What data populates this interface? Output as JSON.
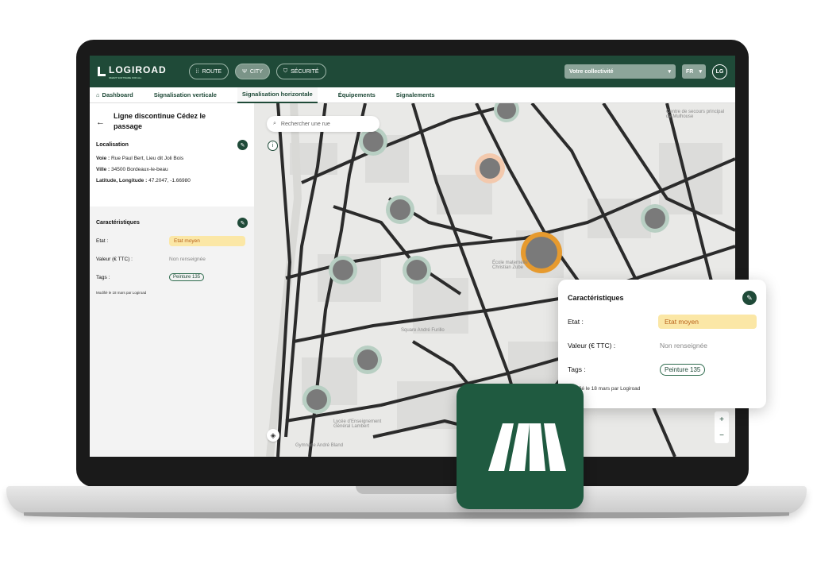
{
  "header": {
    "logo_text": "LOGIROAD",
    "logo_sub": "SMART SOFTWARE FOR ALL",
    "modes": [
      {
        "label": "ROUTE",
        "icon": "road-icon"
      },
      {
        "label": "CITY",
        "icon": "fork-icon"
      },
      {
        "label": "SÉCURITÉ",
        "icon": "shield-icon"
      }
    ],
    "collectivite": "Votre collectivité",
    "lang": "FR",
    "user_initials": "LG"
  },
  "tabs": [
    "Dashboard",
    "Signalisation verticale",
    "Signalisation horizontale",
    "Équipements",
    "Signalements"
  ],
  "panel": {
    "title": "Ligne discontinue Cédez le passage",
    "localisation_title": "Localisation",
    "voie_label": "Voie :",
    "voie": "Rue Paul Bert, Lieu dit Joli Bois",
    "ville_label": "Ville :",
    "ville": "34500 Bordeaux-le-beau",
    "latlon_label": "Latitude, Longitude :",
    "latlon": "47.2047, -1.66980",
    "caract_title": "Caractéristiques",
    "etat_label": "Etat :",
    "etat_value": "Etat moyen",
    "valeur_label": "Valeur (€ TTC) :",
    "valeur_value": "Non renseignée",
    "tags_label": "Tags :",
    "tag_value": "Peinture 135",
    "modified": "Modifié le 18 mars par Logiroad"
  },
  "map": {
    "search_placeholder": "Rechercher une rue",
    "labels": [
      "Centre de secours principal de Mulhouse",
      "Square André Furillo",
      "Lycée d'Enseignement Général Lambert",
      "Gymnase André Bland",
      "École maternelle Christian Zube"
    ]
  },
  "card": {
    "title": "Caractéristiques",
    "etat_label": "Etat :",
    "etat_value": "Etat moyen",
    "valeur_label": "Valeur (€ TTC) :",
    "valeur_value": "Non renseignée",
    "tags_label": "Tags :",
    "tag_value": "Peinture 135",
    "modified": "Modifié le 18 mars par Logiroad"
  },
  "colors": {
    "brand": "#1f4a38",
    "accent_orange": "#e69a2e",
    "badge_yellow": "#fbe7a6"
  }
}
